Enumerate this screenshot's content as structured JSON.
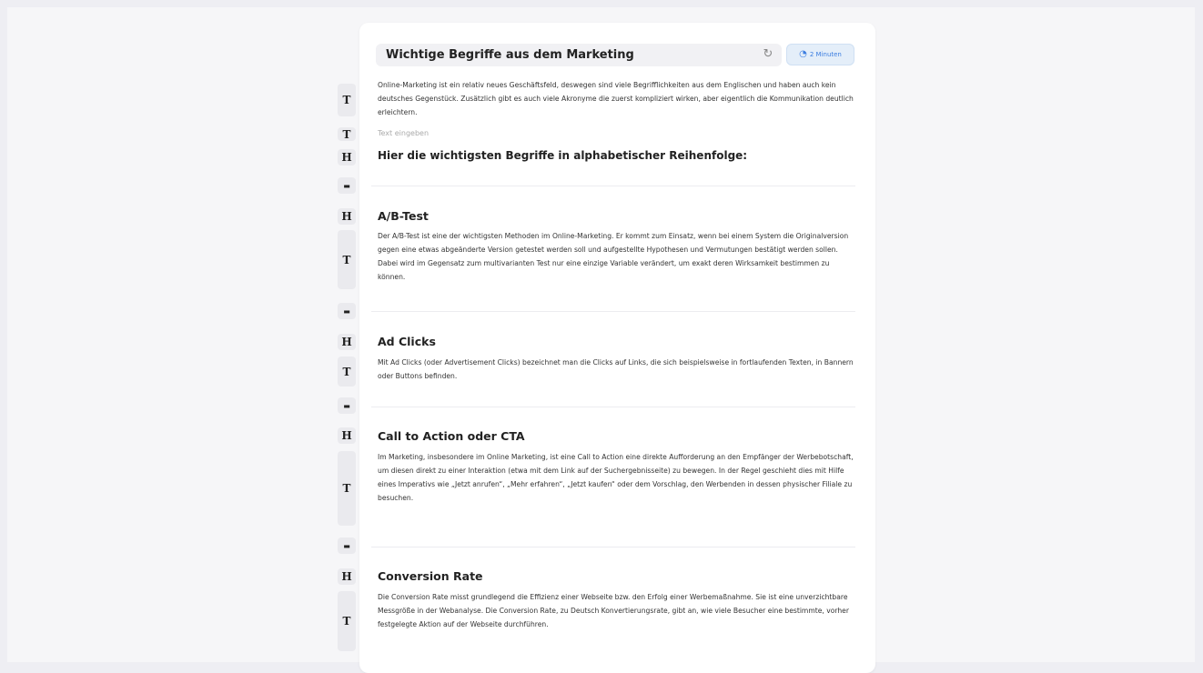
{
  "header": {
    "title": "Wichtige Begriffe aus dem Marketing",
    "refresh_icon": "refresh-icon",
    "reading_time": "2 Minuten",
    "clock_icon": "clock-icon"
  },
  "block_chips": {
    "text": "T",
    "heading": "H",
    "divider": "▬"
  },
  "intro": {
    "paragraph": "Online-Marketing ist ein relativ neues Geschäftsfeld, deswegen sind viele Begrifflichkeiten aus dem Englischen und haben auch kein deutsches Gegenstück. Zusätzlich gibt es auch viele Akronyme die zuerst kompliziert wirken, aber eigentlich die Kommunikation deutlich erleichtern.",
    "placeholder": "Text eingeben",
    "heading": "Hier die wichtigsten Begriffe in alphabetischer Reihenfolge:"
  },
  "sections": [
    {
      "title": "A/B-Test",
      "text": "Der A/B-Test ist eine der wichtigsten Methoden im Online-Marketing. Er kommt zum Einsatz, wenn bei einem System die Originalversion gegen eine etwas abgeänderte Version getestet werden soll und aufgestellte Hypothesen und Vermutungen bestätigt werden sollen. Dabei wird im Gegensatz zum multivarianten Test nur eine einzige Variable verändert, um exakt deren Wirksamkeit bestimmen zu können."
    },
    {
      "title": "Ad Clicks",
      "text": "Mit Ad Clicks (oder Advertisement Clicks) bezeichnet man die Clicks auf Links, die sich beispielsweise in fortlaufenden Texten, in Bannern oder Buttons befinden."
    },
    {
      "title": "Call to Action oder CTA",
      "text": "Im Marketing, insbesondere im Online Marketing, ist eine Call to Action eine direkte Aufforderung an den Empfänger der Werbebotschaft, um diesen direkt zu einer Interaktion (etwa mit dem Link auf der Suchergebnisseite) zu bewegen. In der Regel geschieht dies mit Hilfe eines Imperativs wie „Jetzt anrufen“, „Mehr erfahren“, „Jetzt kaufen“ oder dem Vorschlag, den Werbenden in dessen physischer Filiale zu besuchen."
    },
    {
      "title": "Conversion Rate",
      "text": "Die Conversion Rate misst grundlegend die Effizienz einer Webseite bzw. den Erfolg einer Werbemaßnahme. Sie ist eine unverzichtbare Messgröße in der Webanalyse. Die Conversion Rate, zu Deutsch Konvertierungsrate, gibt an, wie viele Besucher eine bestimmte, vorher festgelegte Aktion auf der Webseite durchführen."
    }
  ]
}
